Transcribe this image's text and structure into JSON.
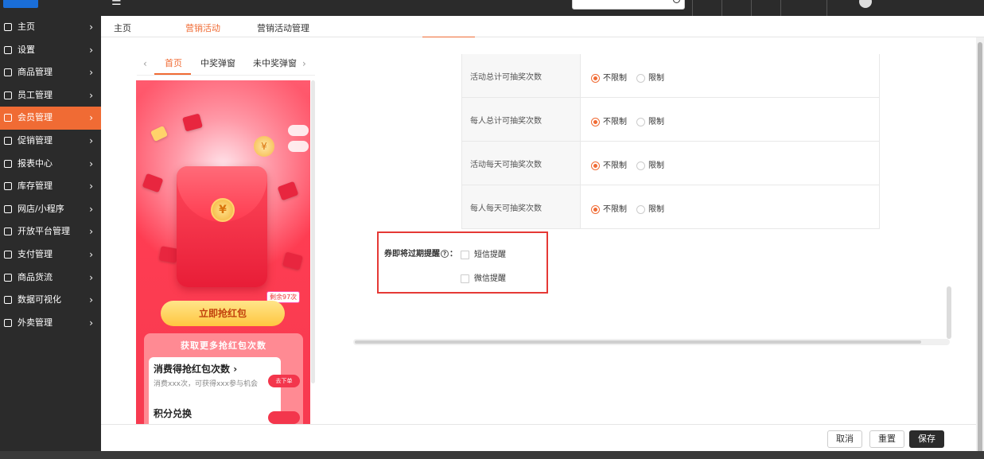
{
  "sidebar": {
    "items": [
      {
        "label": "主页",
        "icon": "home-icon"
      },
      {
        "label": "设置",
        "icon": "gear-icon"
      },
      {
        "label": "商品管理",
        "icon": "box-icon"
      },
      {
        "label": "员工管理",
        "icon": "user-icon"
      },
      {
        "label": "会员管理",
        "icon": "member-card-icon",
        "active": true
      },
      {
        "label": "促销管理",
        "icon": "check-circle-icon"
      },
      {
        "label": "报表中心",
        "icon": "bar-chart-icon"
      },
      {
        "label": "库存管理",
        "icon": "pie-chart-icon"
      },
      {
        "label": "网店/小程序",
        "icon": "store-icon"
      },
      {
        "label": "开放平台管理",
        "icon": "monitor-icon"
      },
      {
        "label": "支付管理",
        "icon": "payment-icon"
      },
      {
        "label": "商品货流",
        "icon": "flow-icon"
      },
      {
        "label": "数据可视化",
        "icon": "line-chart-icon"
      },
      {
        "label": "外卖管理",
        "icon": "takeout-icon"
      }
    ]
  },
  "tabs": [
    {
      "label": "主页"
    },
    {
      "label": "营销活动",
      "active": true
    },
    {
      "label": "营销活动管理"
    }
  ],
  "preview": {
    "tabs": [
      {
        "label": "首页",
        "active": true
      },
      {
        "label": "中奖弹窗"
      },
      {
        "label": "未中奖弹窗"
      }
    ],
    "remaining": "剩余97次",
    "grab_button": "立即抢红包",
    "more_title": "获取更多抢红包次数",
    "task1_title": "消费得抢红包次数",
    "task1_desc": "消费xxx次，可获得xxx参与机会",
    "task1_button": "去下单",
    "task2_title": "积分兑换"
  },
  "settings": {
    "rows": [
      {
        "label": "活动总计可抽奖次数",
        "opt1": "不限制",
        "opt2": "限制",
        "selected": "不限制"
      },
      {
        "label": "每人总计可抽奖次数",
        "opt1": "不限制",
        "opt2": "限制",
        "selected": "不限制"
      },
      {
        "label": "活动每天可抽奖次数",
        "opt1": "不限制",
        "opt2": "限制",
        "selected": "不限制"
      },
      {
        "label": "每人每天可抽奖次数",
        "opt1": "不限制",
        "opt2": "限制",
        "selected": "不限制"
      }
    ]
  },
  "reminder": {
    "label": "券即将过期提醒",
    "colon": "：",
    "sms": "短信提醒",
    "wechat": "微信提醒"
  },
  "footer": {
    "cancel": "取消",
    "reset": "重置",
    "save": "保存"
  },
  "colors": {
    "accent": "#f06b34",
    "sidebar_bg": "#2b2b2b",
    "highlight": "#e53935"
  }
}
